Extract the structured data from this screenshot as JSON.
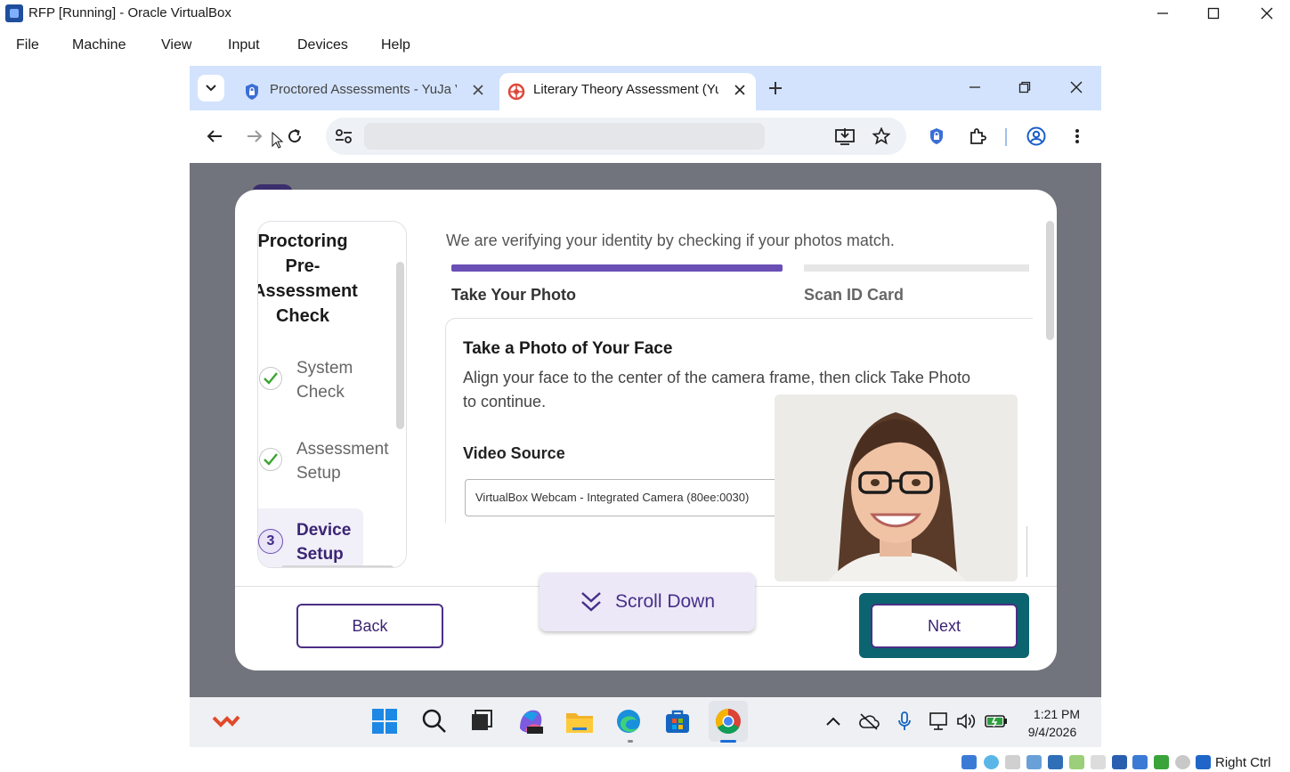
{
  "vbox": {
    "title": "RFP [Running] - Oracle VirtualBox",
    "menu": [
      "File",
      "Machine",
      "View",
      "Input",
      "Devices",
      "Help"
    ],
    "host_key": "Right Ctrl"
  },
  "browser": {
    "tabs": [
      {
        "title": "Proctored Assessments - YuJa V",
        "active": false
      },
      {
        "title": "Literary Theory Assessment (YuJ",
        "active": true
      }
    ],
    "address_value": ""
  },
  "sidebar": {
    "heading": "Proctoring Pre-Assessment Check",
    "heading_lines": [
      "Proctoring",
      "Pre-",
      "Assessment",
      "Check"
    ],
    "steps": [
      {
        "label_lines": [
          "System",
          "Check"
        ],
        "state": "complete"
      },
      {
        "label_lines": [
          "Assessment",
          "Setup"
        ],
        "state": "complete"
      },
      {
        "number": "3",
        "label_lines": [
          "Device",
          "Setup"
        ],
        "state": "current"
      }
    ]
  },
  "verify": {
    "intro": "We are verifying your identity by checking if your photos match.",
    "tabs": [
      "Take Your Photo",
      "Scan ID Card"
    ],
    "progress": [
      1,
      0
    ],
    "card_title": "Take a Photo of Your Face",
    "card_desc_lines": [
      "Align your face to the center of the camera frame, then click Take Photo",
      "to continue."
    ],
    "video_source_label": "Video Source",
    "video_source_value": "VirtualBox Webcam - Integrated Camera (80ee:0030)"
  },
  "buttons": {
    "back": "Back",
    "next": "Next",
    "scroll_down": "Scroll Down"
  },
  "taskbar": {
    "time": "1:21 PM",
    "date": "9/4/2026"
  },
  "colors": {
    "accent": "#6a4fb5",
    "button_border": "#4b2f86",
    "focus_ring": "#0c6470",
    "tab_strip": "#d3e3fd",
    "check_green": "#3aa52f"
  }
}
